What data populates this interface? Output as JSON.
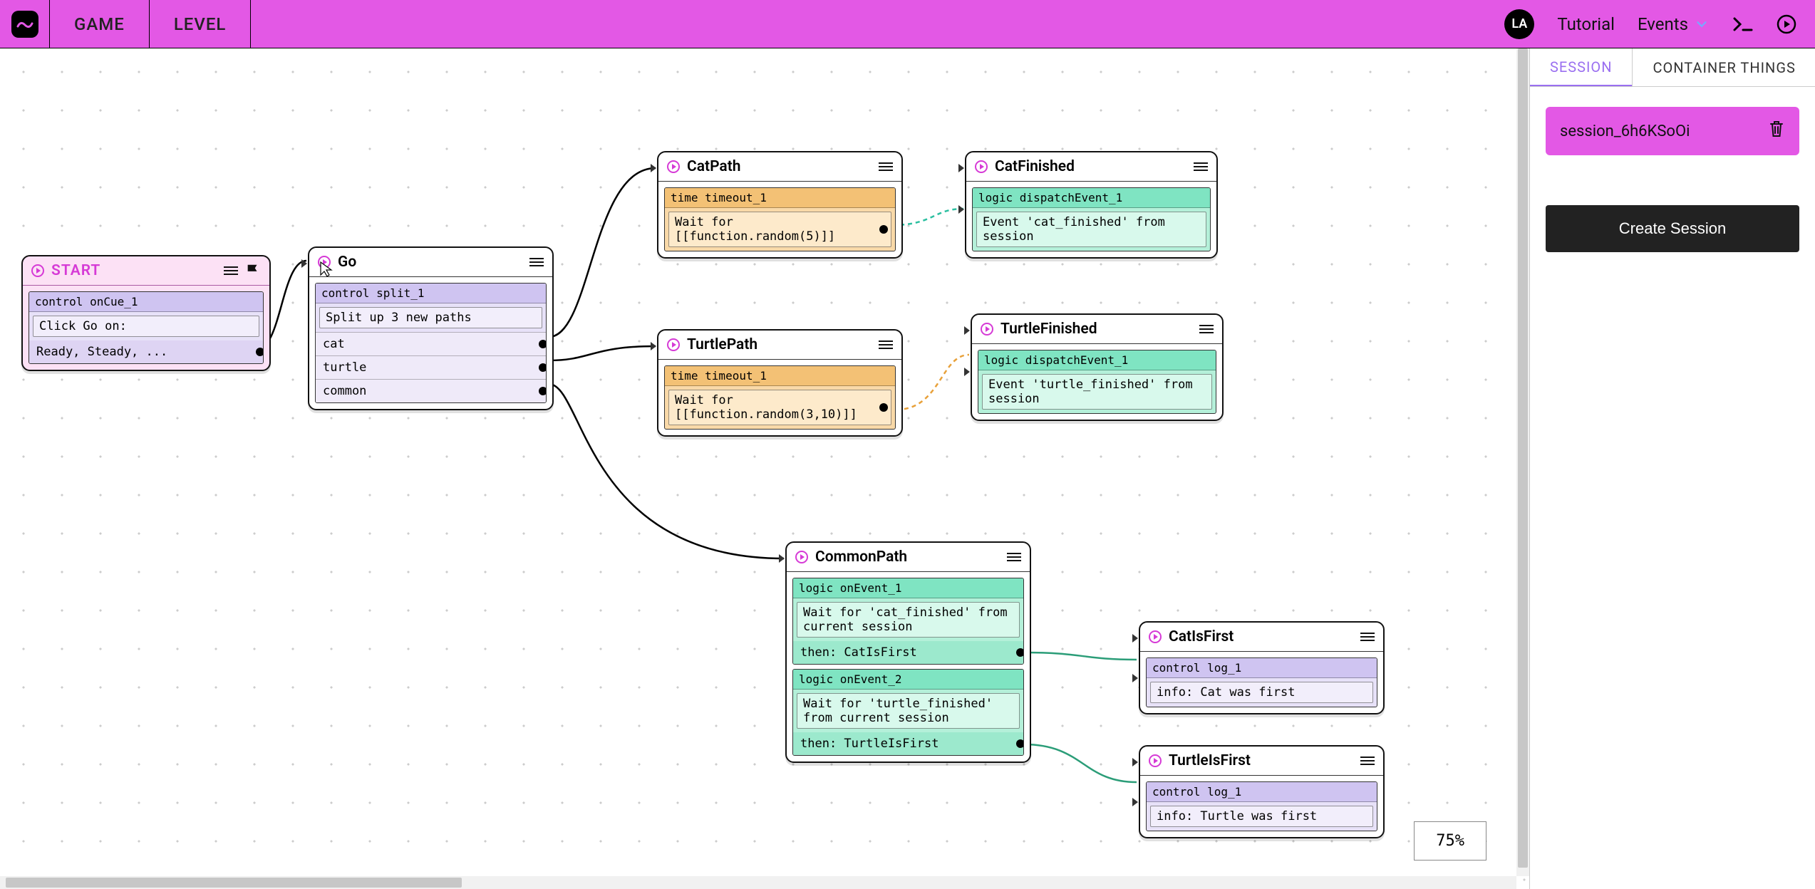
{
  "header": {
    "nav": {
      "game": "GAME",
      "level": "LEVEL"
    },
    "avatar": "LA",
    "tutorial": "Tutorial",
    "events": "Events"
  },
  "canvas": {
    "zoom": "75%",
    "nodes": {
      "start": {
        "title": "START",
        "block_head": "control onCue_1",
        "line1": "Click Go on:",
        "line2": "Ready, Steady, ..."
      },
      "go": {
        "title": "Go",
        "block_head": "control split_1",
        "desc": "Split up 3 new paths",
        "paths": [
          "cat",
          "turtle",
          "common"
        ]
      },
      "catpath": {
        "title": "CatPath",
        "block_head": "time timeout_1",
        "body": "Wait for [[function.random(5)]]"
      },
      "catfinished": {
        "title": "CatFinished",
        "block_head": "logic dispatchEvent_1",
        "body": "Event 'cat_finished' from session"
      },
      "turtlepath": {
        "title": "TurtlePath",
        "block_head": "time timeout_1",
        "body": "Wait for [[function.random(3,10)]]"
      },
      "turtlefinished": {
        "title": "TurtleFinished",
        "block_head": "logic dispatchEvent_1",
        "body": "Event 'turtle_finished' from session"
      },
      "commonpath": {
        "title": "CommonPath",
        "ev1_head": "logic onEvent_1",
        "ev1_body": "Wait for 'cat_finished' from current session",
        "ev1_then": "then: CatIsFirst",
        "ev2_head": "logic onEvent_2",
        "ev2_body": "Wait for 'turtle_finished' from current session",
        "ev2_then": "then: TurtleIsFirst"
      },
      "catisfirst": {
        "title": "CatIsFirst",
        "block_head": "control log_1",
        "body": "info: Cat was first"
      },
      "turtleisfirst": {
        "title": "TurtleIsFirst",
        "block_head": "control log_1",
        "body": "info: Turtle was first"
      }
    }
  },
  "side": {
    "tabs": {
      "session": "SESSION",
      "container": "CONTAINER THINGS"
    },
    "session_id": "session_6h6KSoOi",
    "create": "Create Session"
  }
}
